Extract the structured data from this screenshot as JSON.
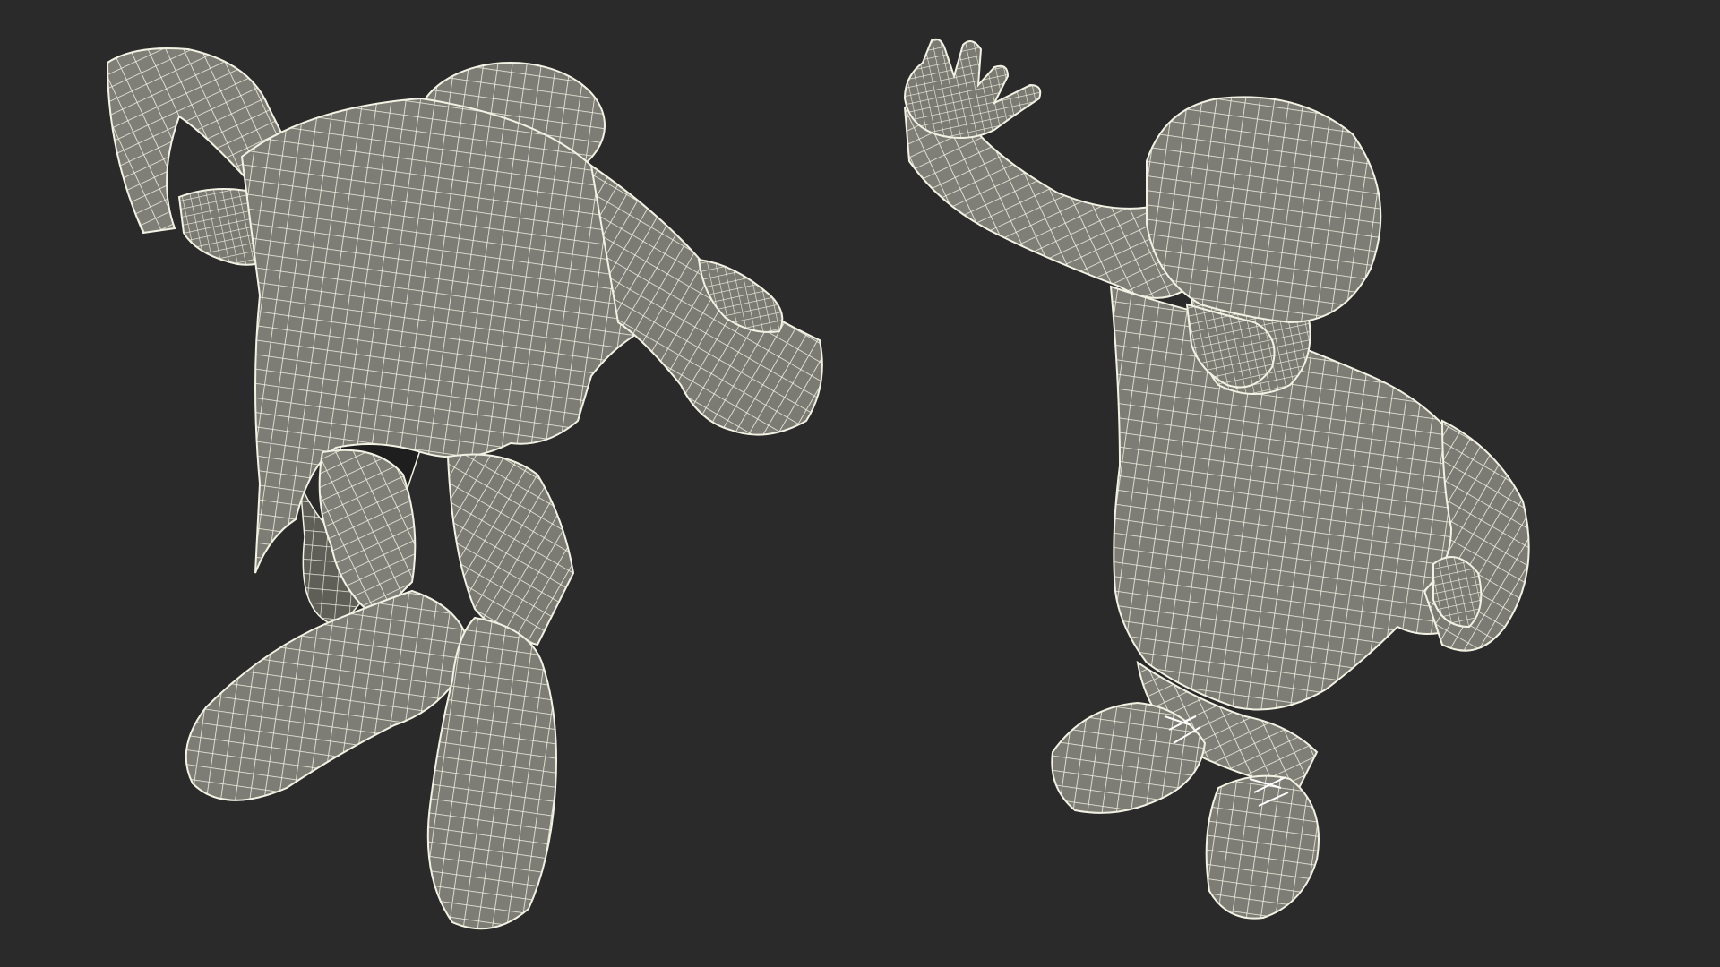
{
  "scene": {
    "background_color": "#2a2a2a",
    "mesh_fill_color": "#7d7d75",
    "mesh_shadow_color": "#5f5f58",
    "wire_color": "#f2f2e4",
    "models": [
      {
        "view": "bottom",
        "subject": "boy-figure-wireframe"
      },
      {
        "view": "top",
        "subject": "boy-figure-wireframe"
      }
    ]
  }
}
